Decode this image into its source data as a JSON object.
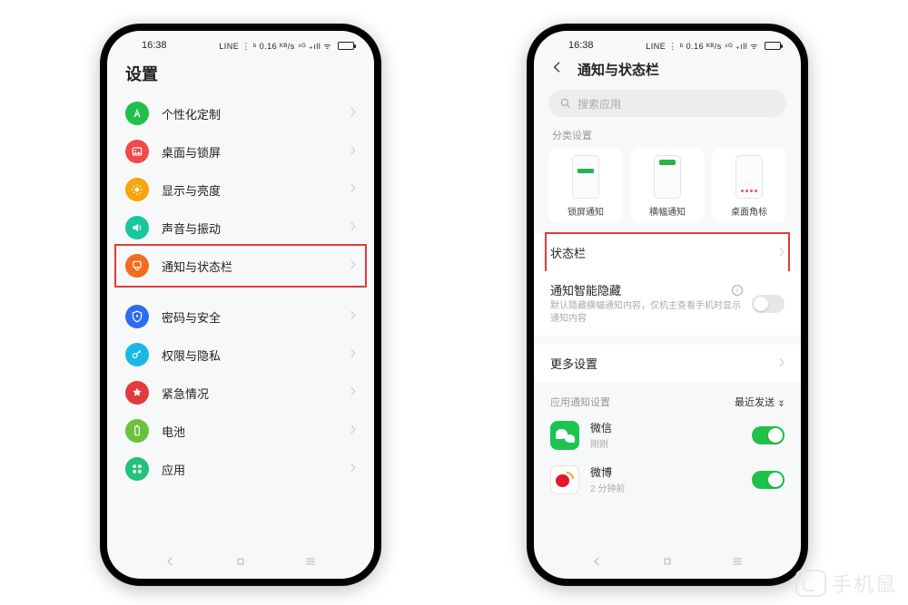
{
  "status": {
    "time": "16:38",
    "indicators": "LINE ⋮ ᵇ 0.16 ᴷᴮ/s ⁴ᴳ ₊ıll ᯤ"
  },
  "left": {
    "title": "设置",
    "items": [
      {
        "label": "个性化定制",
        "color": "#1fc14a",
        "icon": "font"
      },
      {
        "label": "桌面与锁屏",
        "color": "#ef4b4b",
        "icon": "image"
      },
      {
        "label": "显示与亮度",
        "color": "#f7a50a",
        "icon": "sun"
      },
      {
        "label": "声音与振动",
        "color": "#18c6a0",
        "icon": "sound"
      },
      {
        "label": "通知与状态栏",
        "color": "#f36c1f",
        "icon": "bell",
        "highlight": true
      },
      {
        "gap": true
      },
      {
        "label": "密码与安全",
        "color": "#2f6bf0",
        "icon": "shield"
      },
      {
        "label": "权限与隐私",
        "color": "#18b9e6",
        "icon": "key"
      },
      {
        "label": "紧急情况",
        "color": "#e23b3b",
        "icon": "sos"
      },
      {
        "label": "电池",
        "color": "#6ac23c",
        "icon": "battery"
      },
      {
        "label": "应用",
        "color": "#22c27a",
        "icon": "apps"
      }
    ]
  },
  "right": {
    "header": "通知与状态栏",
    "search_placeholder": "搜索应用",
    "section_category": "分类设置",
    "cards": [
      {
        "label": "锁屏通知",
        "style": "bar-mid"
      },
      {
        "label": "横幅通知",
        "style": "bar-top"
      },
      {
        "label": "桌面角标",
        "style": "dots-red"
      }
    ],
    "status_bar_row": "状态栏",
    "smart_hide": {
      "title": "通知智能隐藏",
      "desc": "默认隐藏横幅通知内容，仅机主查看手机时显示通知内容",
      "on": false
    },
    "more_settings": "更多设置",
    "app_section": "应用通知设置",
    "sort_label": "最近发送",
    "apps": [
      {
        "name": "微信",
        "sub": "刚刚",
        "kind": "wechat",
        "on": true
      },
      {
        "name": "微博",
        "sub": "2 分钟前",
        "kind": "weibo",
        "on": true
      }
    ]
  },
  "watermark": "手机鼠"
}
